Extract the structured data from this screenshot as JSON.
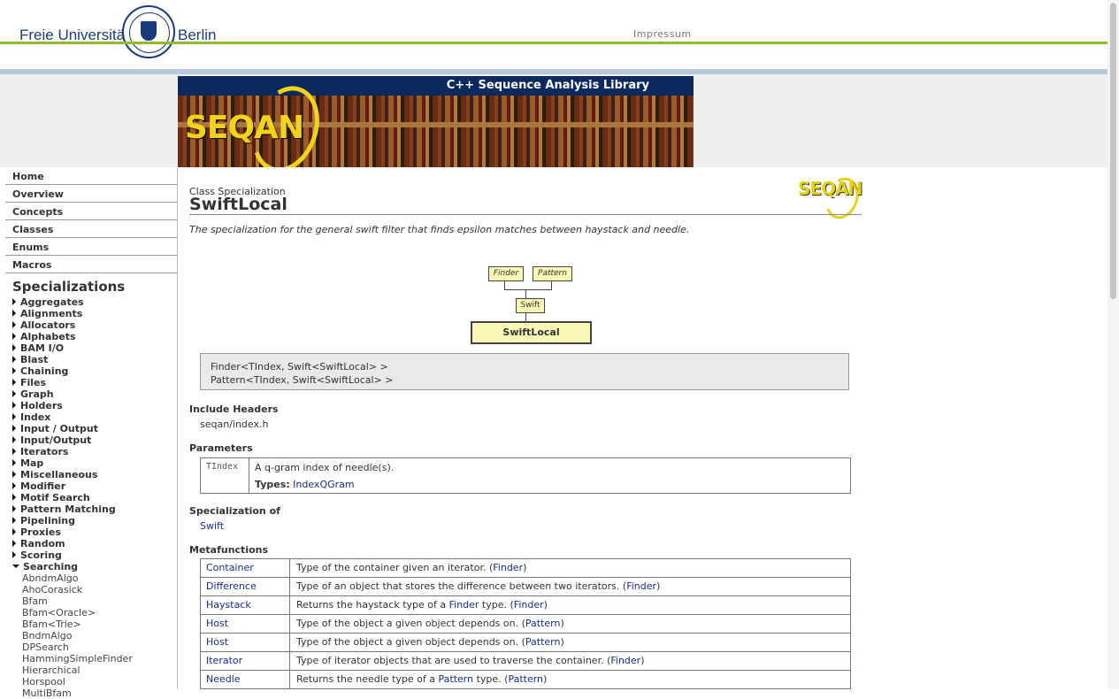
{
  "header": {
    "fu_left": "Freie Universität",
    "fu_right": "Berlin",
    "impressum": "Impressum"
  },
  "banner": {
    "title": "C++ Sequence Analysis Library",
    "logo_text": "SEQAN"
  },
  "sidebar": {
    "nav": [
      "Home",
      "Overview",
      "Concepts",
      "Classes",
      "Enums",
      "Macros"
    ],
    "specializations_title": "Specializations",
    "categories": [
      "Aggregates",
      "Alignments",
      "Allocators",
      "Alphabets",
      "BAM I/O",
      "Blast",
      "Chaining",
      "Files",
      "Graph",
      "Holders",
      "Index",
      "Input / Output",
      "Input/Output",
      "Iterators",
      "Map",
      "Miscellaneous",
      "Modifier",
      "Motif Search",
      "Pattern Matching",
      "Pipelining",
      "Proxies",
      "Random",
      "Scoring"
    ],
    "expanded_category": "Searching",
    "sub_items": [
      "AbndmAlgo",
      "AhoCorasick",
      "Bfam",
      "Bfam<Oracle>",
      "Bfam<Trie>",
      "BndmAlgo",
      "DPSearch",
      "HammingSimpleFinder",
      "Hierarchical",
      "Horspool",
      "MultiBfam"
    ]
  },
  "page": {
    "kind": "Class Specialization",
    "title": "SwiftLocal",
    "logo_text": "SEQAN",
    "description": "The specialization for the general swift filter that finds epsilon matches between haystack and needle.",
    "diagram": {
      "parent_left": "Finder",
      "parent_right": "Pattern",
      "middle": "Swift",
      "current": "SwiftLocal"
    },
    "signature": [
      "Finder<TIndex, Swift<SwiftLocal> >",
      "Pattern<TIndex, Swift<SwiftLocal> >"
    ],
    "include_headers_title": "Include Headers",
    "include_header": "seqan/index.h",
    "parameters_title": "Parameters",
    "param_name": "TIndex",
    "param_desc": "A q-gram index of needle(s).",
    "param_types_label": "Types:",
    "param_types_value": "IndexQGram",
    "specialization_of_title": "Specialization of",
    "specialization_of": "Swift",
    "metafunctions_title": "Metafunctions",
    "metafunctions": [
      {
        "name": "Container",
        "pre": "Type of the container given an iterator. (",
        "mid": "",
        "mid_link": "",
        "post_link": "Finder",
        "post": ")"
      },
      {
        "name": "Difference",
        "pre": "Type of an object that stores the difference between two iterators. (",
        "mid": "",
        "mid_link": "",
        "post_link": "Finder",
        "post": ")"
      },
      {
        "name": "Haystack",
        "pre": "Returns the haystack type of a ",
        "mid_link": "Finder",
        "mid": " type. (",
        "post_link": "Finder",
        "post": ")"
      },
      {
        "name": "Host",
        "pre": "Type of the object a given object depends on. (",
        "mid": "",
        "mid_link": "",
        "post_link": "Pattern",
        "post": ")"
      },
      {
        "name": "Host",
        "pre": "Type of the object a given object depends on. (",
        "mid": "",
        "mid_link": "",
        "post_link": "Pattern",
        "post": ")"
      },
      {
        "name": "Iterator",
        "pre": "Type of iterator objects that are used to traverse the container. (",
        "mid": "",
        "mid_link": "",
        "post_link": "Finder",
        "post": ")"
      },
      {
        "name": "Needle",
        "pre": "Returns the needle type of a ",
        "mid_link": "Pattern",
        "mid": " type. (",
        "post_link": "Pattern",
        "post": ")"
      }
    ]
  },
  "colors": {
    "fu_blue": "#1b3c7a",
    "fu_green": "#8fbc2b",
    "banner_navy": "#0a2a5e",
    "seqan_yellow": "#f2d21a",
    "link": "#1a2a8a",
    "diagram_fill": "#fbf8b7"
  }
}
